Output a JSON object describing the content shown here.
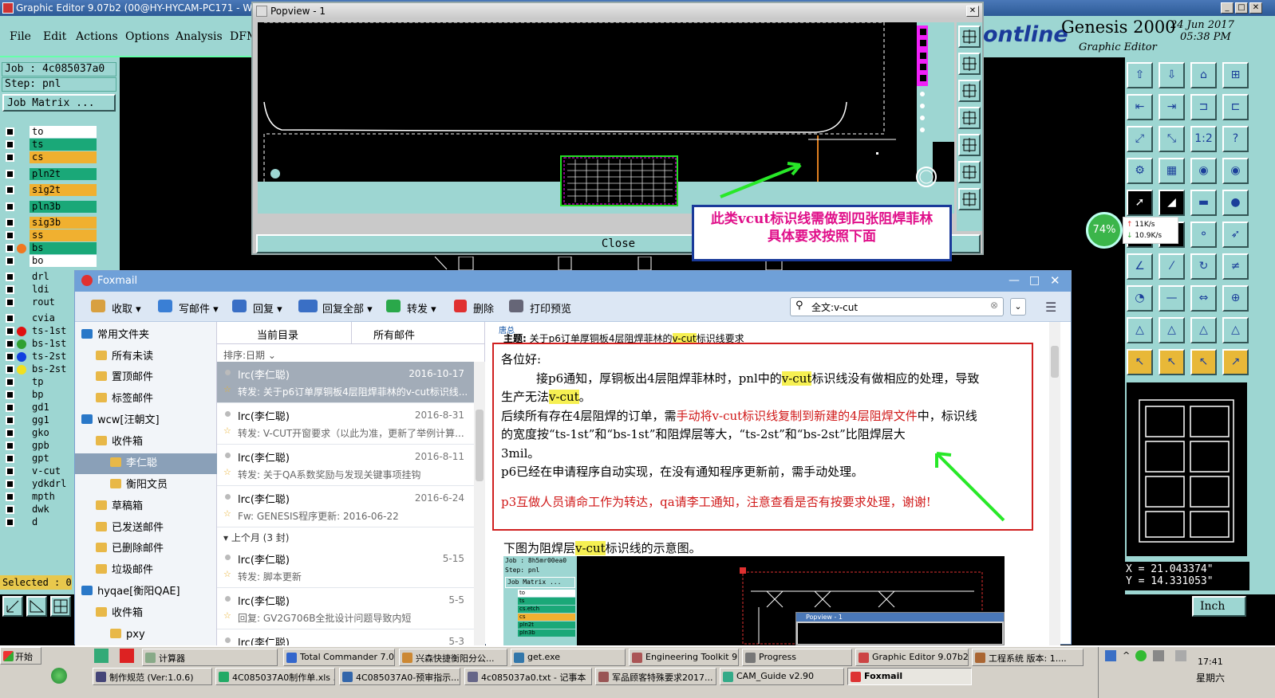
{
  "genesis": {
    "window_title": "Graphic Editor 9.07b2 (00@HY-HYCAM-PC171 - Windo",
    "menu": [
      "File",
      "Edit",
      "Actions",
      "Options",
      "Analysis",
      "DFM"
    ],
    "logo_text": "ontline",
    "product_title": "Genesis 2000",
    "product_subtitle": "Graphic Editor",
    "date": "24 Jun 2017",
    "time": "05:38 PM",
    "job_label": "Job : 4c085037a0",
    "step_label": "Step: pnl",
    "job_matrix_button": "Job Matrix ...",
    "layers": [
      {
        "name": "to",
        "color": "#ffffff",
        "dot": ""
      },
      {
        "name": "ts",
        "color": "#1aa878",
        "dot": ""
      },
      {
        "name": "cs",
        "color": "#f0b030",
        "dot": ""
      },
      {
        "name": "pln2t",
        "color": "#1aa878",
        "dot": ""
      },
      {
        "name": "sig2t",
        "color": "#f0b030",
        "dot": ""
      },
      {
        "name": "pln3b",
        "color": "#1aa878",
        "dot": ""
      },
      {
        "name": "sig3b",
        "color": "#f0b030",
        "dot": ""
      },
      {
        "name": "ss",
        "color": "#f0b030",
        "dot": ""
      },
      {
        "name": "bs",
        "color": "#1aa878",
        "dot": "#f07820"
      },
      {
        "name": "bo",
        "color": "#ffffff",
        "dot": ""
      },
      {
        "name": "drl",
        "color": "#9dd6d2",
        "dot": ""
      },
      {
        "name": "ldi",
        "color": "#9dd6d2",
        "dot": ""
      },
      {
        "name": "rout",
        "color": "#9dd6d2",
        "dot": ""
      },
      {
        "name": "cvia",
        "color": "#9dd6d2",
        "dot": ""
      },
      {
        "name": "ts-1st",
        "color": "#9dd6d2",
        "dot": "#e01010"
      },
      {
        "name": "bs-1st",
        "color": "#9dd6d2",
        "dot": "#30a030"
      },
      {
        "name": "ts-2st",
        "color": "#9dd6d2",
        "dot": "#1040e0"
      },
      {
        "name": "bs-2st",
        "color": "#9dd6d2",
        "dot": "#f0e020"
      },
      {
        "name": "tp",
        "color": "#9dd6d2",
        "dot": ""
      },
      {
        "name": "bp",
        "color": "#9dd6d2",
        "dot": ""
      },
      {
        "name": "gd1",
        "color": "#9dd6d2",
        "dot": ""
      },
      {
        "name": "gg1",
        "color": "#9dd6d2",
        "dot": ""
      },
      {
        "name": "gko",
        "color": "#9dd6d2",
        "dot": ""
      },
      {
        "name": "gpb",
        "color": "#9dd6d2",
        "dot": ""
      },
      {
        "name": "gpt",
        "color": "#9dd6d2",
        "dot": ""
      },
      {
        "name": "v-cut",
        "color": "#9dd6d2",
        "dot": ""
      },
      {
        "name": "ydkdrl",
        "color": "#9dd6d2",
        "dot": ""
      },
      {
        "name": "mpth",
        "color": "#9dd6d2",
        "dot": ""
      },
      {
        "name": "dwk",
        "color": "#9dd6d2",
        "dot": ""
      },
      {
        "name": "d",
        "color": "#9dd6d2",
        "dot": ""
      }
    ],
    "selected_label": "Selected : 0",
    "coord_x": "X = 21.043374\"",
    "coord_y": "Y = 14.331053\"",
    "units_button": "Inch",
    "net_percent": "74%",
    "net_up": "11K/s",
    "net_down": "10.9K/s"
  },
  "popview": {
    "title": "Popview - 1",
    "close_button": "Close",
    "annotation": "此类vcut标识线需做到四张阻焊菲林　 具体要求按照下面"
  },
  "foxmail": {
    "title": "Foxmail",
    "toolbar": [
      "收取",
      "写邮件",
      "回复",
      "回复全部",
      "转发",
      "删除",
      "打印预览"
    ],
    "search_value": "全文:v-cut",
    "folders": [
      {
        "label": "常用文件夹",
        "indent": 0,
        "sel": false
      },
      {
        "label": "所有未读",
        "indent": 1,
        "sel": false
      },
      {
        "label": "置顶邮件",
        "indent": 1,
        "sel": false
      },
      {
        "label": "标签邮件",
        "indent": 1,
        "sel": false
      },
      {
        "label": "wcw[汪朝文]",
        "indent": 0,
        "sel": false
      },
      {
        "label": "收件箱",
        "indent": 1,
        "sel": false
      },
      {
        "label": "李仁聪",
        "indent": 2,
        "sel": true
      },
      {
        "label": "衡阳文员",
        "indent": 2,
        "sel": false
      },
      {
        "label": "草稿箱",
        "indent": 1,
        "sel": false
      },
      {
        "label": "已发送邮件",
        "indent": 1,
        "sel": false
      },
      {
        "label": "已删除邮件",
        "indent": 1,
        "sel": false
      },
      {
        "label": "垃圾邮件",
        "indent": 1,
        "sel": false
      },
      {
        "label": "hyqae[衡阳QAE]",
        "indent": 0,
        "sel": false
      },
      {
        "label": "收件箱",
        "indent": 1,
        "sel": false
      },
      {
        "label": "pxy",
        "indent": 2,
        "sel": false
      }
    ],
    "list_tabs": [
      "当前目录",
      "所有邮件"
    ],
    "sort_label": "排序:日期",
    "group_header": "上个月 (3 封)",
    "mails": [
      {
        "from": "lrc(李仁聪)",
        "date": "2016-10-17",
        "subject": "转发: 关于p6订单厚铜板4层阻焊菲林的v-cut标识线..."
      },
      {
        "from": "lrc(李仁聪)",
        "date": "2016-8-31",
        "subject": "转发: V-CUT开窗要求（以此为准，更新了举例计算..."
      },
      {
        "from": "lrc(李仁聪)",
        "date": "2016-8-11",
        "subject": "转发: 关于QA系数奖励与发现关键事项挂钩"
      },
      {
        "from": "lrc(李仁聪)",
        "date": "2016-6-24",
        "subject": "Fw: GENESIS程序更新: 2016-06-22"
      },
      {
        "from": "lrc(李仁聪)",
        "date": "5-15",
        "subject": "转发: 脚本更新"
      },
      {
        "from": "lrc(李仁聪)",
        "date": "5-5",
        "subject": "回复: GV2G706B全批设计问题导致内短"
      },
      {
        "from": "lrc(李仁聪)",
        "date": "5-3",
        "subject": ""
      }
    ],
    "read": {
      "subject_label": "主题:",
      "subject_prefix": "关于p6订单厚铜板4层阻焊菲林的",
      "subject_hl": "v-cut",
      "subject_suffix": "标识线要求",
      "greeting": "各位好:",
      "p1a": "接p6通知，厚铜板出4层阻焊菲林时，pnl中的",
      "p1b": "v-cut",
      "p1c": "标识线没有做相应的处理，导致",
      "p1d": "生产无法",
      "p1e": "v-cut",
      "p1f": "。",
      "p2a": "后续所有存在4层阻焊的订单，需",
      "p2b": "手动将v-cut标识线复制到新建的4层阻焊文件",
      "p2c": "中，标识线",
      "p2d": "的宽度按“ts-1st”和“bs-1st”和阻焊层等大，“ts-2st”和“bs-2st”比阻焊层大",
      "p2e": "3mil。",
      "p3": "p6已经在申请程序自动实现，在没有通知程序更新前，需手动处理。",
      "p4": "p3互做人员请命工作为转达，qa请李工通知，注意查看是否有按要求处理，谢谢!",
      "caption_a": "下图为阻焊层",
      "caption_b": "v-cut",
      "caption_c": "标识线的示意图。",
      "thumb_job": "Job : 8h5mr00ea0",
      "thumb_step": "Step: pnl",
      "thumb_matrix": "Job Matrix ...",
      "thumb_layers": [
        "to",
        "ts",
        "cs.etch",
        "cs",
        "pln2t",
        "pln3b"
      ],
      "thumb_popview": "Popview - 1"
    }
  },
  "taskbar": {
    "start": "开始",
    "row1": [
      "计算器",
      "Total Commander 7.0...",
      "兴森快捷衡阳分公...",
      "get.exe",
      "Engineering Toolkit 9....",
      "Progress",
      "Graphic Editor 9.07b2...",
      "工程系统  版本: 1...."
    ],
    "row2": [
      "制作规范 (Ver:1.0.6)",
      "4C085037A0制作单.xls ...",
      "4C085037A0-预审指示...",
      "4c085037a0.txt - 记事本",
      "军品顾客特殊要求2017...",
      "CAM_Guide v2.90",
      "Foxmail"
    ],
    "clock_time": "17:41",
    "clock_day": "星期六"
  }
}
